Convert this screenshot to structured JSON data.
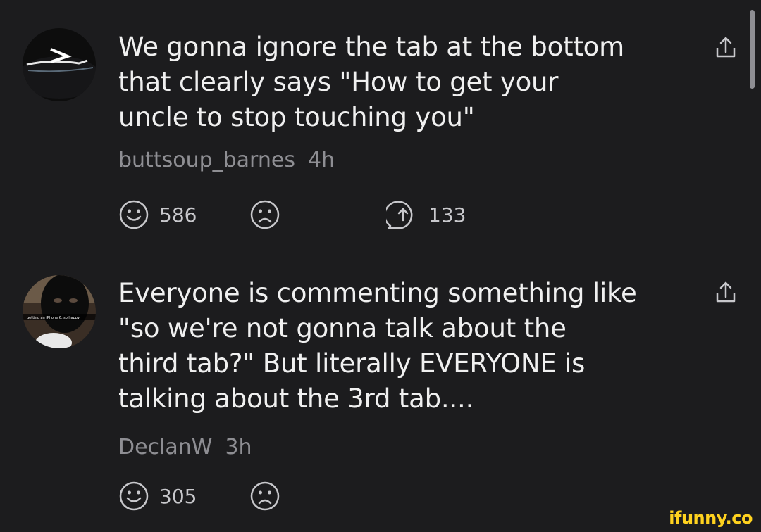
{
  "comments": [
    {
      "text": "We gonna ignore the tab at the bottom\nthat clearly says \"How to get your\nuncle to stop touching you\"",
      "username": "buttsoup_barnes",
      "time": "4h",
      "likes": "586",
      "replies": "133"
    },
    {
      "text": "Everyone is commenting something like\n\"so we're not gonna talk about the\nthird tab?\" But literally EVERYONE is\ntalking about the 3rd tab....",
      "username": "DeclanW",
      "time": "3h",
      "likes": "305",
      "avatar_caption": "getting an iPhone 6, so happy"
    }
  ],
  "watermark": "ifunny.co",
  "colors": {
    "background": "#1c1c1e",
    "text": "#f0f0f0",
    "meta": "#8e8e93",
    "watermark": "#ffd21f"
  },
  "icons": [
    "smile-icon",
    "frown-icon",
    "reply-icon",
    "share-icon"
  ]
}
